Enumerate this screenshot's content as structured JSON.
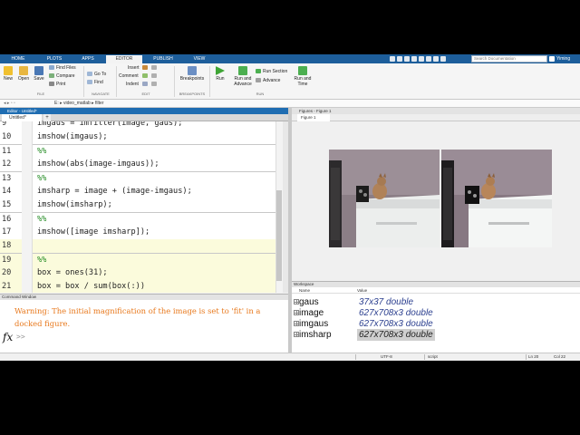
{
  "tabs": [
    "HOME",
    "PLOTS",
    "APPS",
    "EDITOR",
    "PUBLISH",
    "VIEW"
  ],
  "search_placeholder": "Search Documentation",
  "user_name": "Yiming",
  "ribbon": {
    "file": {
      "new": "New",
      "open": "Open",
      "save": "Save",
      "find_files": "Find Files",
      "compare": "Compare",
      "print": "Print",
      "section": "FILE"
    },
    "navigate": {
      "go_to": "Go To",
      "find": "Find",
      "section": "NAVIGATE"
    },
    "edit": {
      "insert": "Insert",
      "comment": "Comment",
      "indent": "Indent",
      "fx": "fx",
      "section": "EDIT"
    },
    "breakpoints": {
      "label": "Breakpoints",
      "section": "BREAKPOINTS"
    },
    "run": {
      "run": "Run",
      "run_advance": "Run and Advance",
      "run_section": "Run Section",
      "advance": "Advance",
      "run_time": "Run and Time",
      "section": "RUN"
    }
  },
  "address_path": "E: ▸ video_matlab ▸ filter",
  "editor": {
    "title": "Editor - Untitled*",
    "tab": "Untitled*",
    "lines": [
      {
        "num": "9",
        "text": "imgaus = imfilter(image, gaus);",
        "kind": "code"
      },
      {
        "num": "10",
        "text": "imshow(imgaus);",
        "kind": "code"
      },
      {
        "num": "11",
        "text": "%%",
        "kind": "comment"
      },
      {
        "num": "12",
        "text": "imshow(abs(image-imgaus));",
        "kind": "code"
      },
      {
        "num": "13",
        "text": "%%",
        "kind": "comment"
      },
      {
        "num": "14",
        "text": "imsharp = image + (image-imgaus);",
        "kind": "code"
      },
      {
        "num": "15",
        "text": "imshow(imsharp);",
        "kind": "code"
      },
      {
        "num": "16",
        "text": "%%",
        "kind": "comment"
      },
      {
        "num": "17",
        "text": "imshow([image imsharp]);",
        "kind": "code"
      },
      {
        "num": "18",
        "text": "",
        "kind": "cell"
      },
      {
        "num": "19",
        "text": "%%",
        "kind": "cellcomment"
      },
      {
        "num": "20",
        "text": "box = ones(31);",
        "kind": "cell"
      },
      {
        "num": "21",
        "text": "box = box / sum(box(:))",
        "kind": "cell"
      }
    ]
  },
  "command_window": {
    "title": "Command Window",
    "warning": "Warning: The initial magnification of the image is set to 'fit' in a docked figure.",
    "fx": "fx",
    "prompt": ">>"
  },
  "figures": {
    "title": "Figures - Figure 1",
    "tab": "Figure 1"
  },
  "workspace": {
    "title": "Workspace",
    "headers": {
      "name": "Name",
      "value": "Value"
    },
    "rows": [
      {
        "name": "gaus",
        "value": "37x37 double",
        "selected": false
      },
      {
        "name": "image",
        "value": "627x708x3 double",
        "selected": false
      },
      {
        "name": "imgaus",
        "value": "627x708x3 double",
        "selected": false
      },
      {
        "name": "imsharp",
        "value": "627x708x3 double",
        "selected": true
      }
    ]
  },
  "status": {
    "encoding": "UTF-8",
    "mode": "script",
    "ln": "Ln  20",
    "col": "Col  22"
  }
}
